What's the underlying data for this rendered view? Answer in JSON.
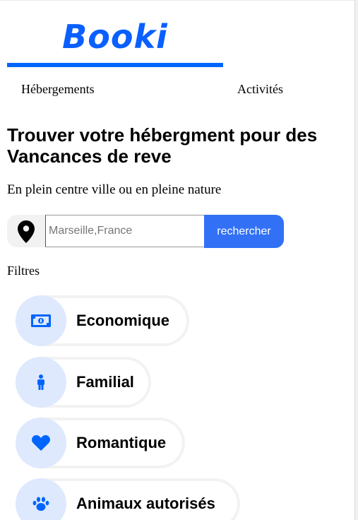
{
  "brand": {
    "logo_text": "Booki",
    "color": "#0065fc"
  },
  "nav": {
    "items": [
      {
        "label": "Hébergements"
      },
      {
        "label": "Activités"
      }
    ]
  },
  "hero": {
    "title": "Trouver votre hébergment pour des Vancances de reve",
    "subtitle": "En plein centre ville ou en pleine nature"
  },
  "search": {
    "icon": "location-pin-icon",
    "value": "",
    "placeholder": "Marseille,France",
    "button_label": "rechercher",
    "button_color": "#3271f6"
  },
  "filters": {
    "label": "Filtres",
    "items": [
      {
        "label": "Economique",
        "icon": "money-bill-icon"
      },
      {
        "label": "Familial",
        "icon": "child-icon"
      },
      {
        "label": "Romantique",
        "icon": "heart-icon"
      },
      {
        "label": "Animaux autorisés",
        "icon": "paw-icon"
      }
    ],
    "circle_color": "#dee9fe",
    "icon_color": "#0065fc"
  }
}
